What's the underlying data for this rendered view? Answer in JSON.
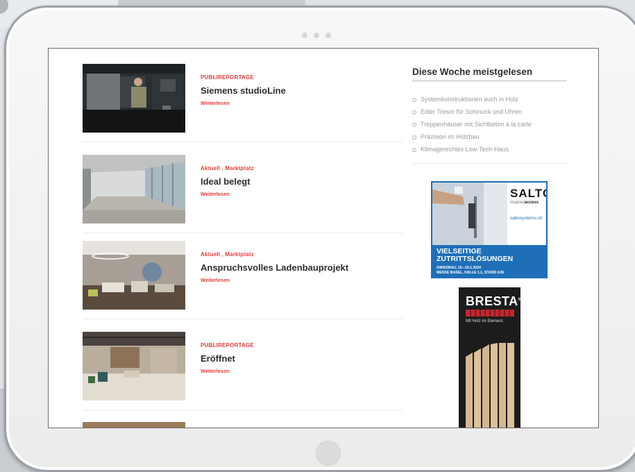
{
  "articles": [
    {
      "category": "PUBLIREPORTAGE",
      "title": "Siemens studioLine",
      "more": "Weiterlesen"
    },
    {
      "category": "Aktuell , Marktplatz",
      "title": "Ideal belegt",
      "more": "Weiterlesen"
    },
    {
      "category": "Aktuell , Marktplatz",
      "title": "Anspruchsvolles Ladenbauprojekt",
      "more": "Weiterlesen"
    },
    {
      "category": "PUBLIREPORTAGE",
      "title": "Eröffnet",
      "more": "Weiterlesen"
    }
  ],
  "sidebar": {
    "title": "Diese Woche meistgelesen",
    "items": [
      "Systemkonstruktionen auch in Holz",
      "Edler Tresor für Schmuck und Uhren",
      "Treppenhäuser mit Sichtbeton à la carte",
      "Präzision im Holzbau",
      "Klimagerechtes Low-Tech-Haus"
    ]
  },
  "ads": {
    "salto": {
      "logo": "SALTO",
      "tagline_a": "inspired",
      "tagline_b": "access",
      "url": "saltosystems.ch",
      "headline_1": "VIELSEITIGE",
      "headline_2": "ZUTRITTSLÖSUNGEN",
      "event_1": "SWISSBAU, 16.–19.1.2024",
      "event_2": "MESSE BASEL, HALLE 1.1, STAND A36"
    },
    "bresta": {
      "logo": "BRESTA",
      "reg": "®",
      "tagline": "Mit Holz im Element."
    }
  },
  "colors": {
    "accent": "#e53b37",
    "salto_blue": "#1e6fb8"
  }
}
